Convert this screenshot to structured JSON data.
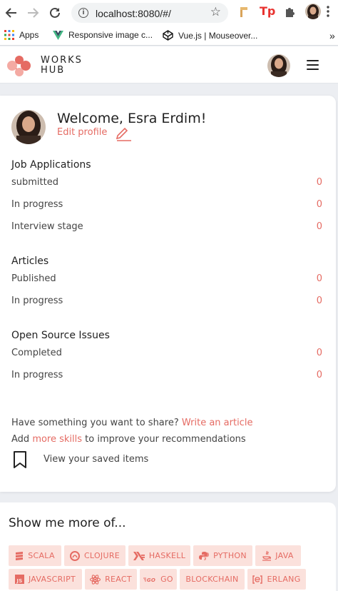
{
  "browser": {
    "url": "localhost:8080/#/",
    "bookmarks": [
      {
        "label": "Apps",
        "icon": "apps-grid-icon"
      },
      {
        "label": "Responsive image c...",
        "icon": "vue-logo-icon"
      },
      {
        "label": "Vue.js | Mouseover...",
        "icon": "codepen-icon"
      }
    ],
    "more_bookmarks": "»"
  },
  "header": {
    "logo_line1": "WORKS",
    "logo_line2": "HUB",
    "brand_color": "#e56b63"
  },
  "dashboard": {
    "welcome": "Welcome, Esra Erdim!",
    "edit_profile": "Edit profile",
    "sections": [
      {
        "title": "Job Applications",
        "rows": [
          {
            "label": "submitted",
            "count": "0"
          },
          {
            "label": "In progress",
            "count": "0"
          },
          {
            "label": "Interview stage",
            "count": "0"
          }
        ]
      },
      {
        "title": "Articles",
        "rows": [
          {
            "label": "Published",
            "count": "0"
          },
          {
            "label": "In progress",
            "count": "0"
          }
        ]
      },
      {
        "title": "Open Source Issues",
        "rows": [
          {
            "label": "Completed",
            "count": "0"
          },
          {
            "label": "In progress",
            "count": "0"
          }
        ]
      }
    ],
    "share_text": "Have something you want to share?",
    "write_article": "Write an article",
    "add_text": "Add",
    "more_skills": "more skills",
    "improve_text": "to improve your recommendations",
    "saved_items": "View your saved items"
  },
  "show_more": {
    "title": "Show me more of...",
    "tags": [
      {
        "label": "SCALA",
        "icon": "scala-icon"
      },
      {
        "label": "CLOJURE",
        "icon": "clojure-icon"
      },
      {
        "label": "HASKELL",
        "icon": "haskell-icon"
      },
      {
        "label": "PYTHON",
        "icon": "python-icon"
      },
      {
        "label": "JAVA",
        "icon": "java-icon"
      },
      {
        "label": "JAVASCRIPT",
        "icon": "javascript-icon"
      },
      {
        "label": "REACT",
        "icon": "react-icon"
      },
      {
        "label": "GO",
        "icon": "go-icon"
      },
      {
        "label": "BLOCKCHAIN",
        "icon": ""
      },
      {
        "label": "ERLANG",
        "icon": "erlang-icon"
      }
    ]
  }
}
